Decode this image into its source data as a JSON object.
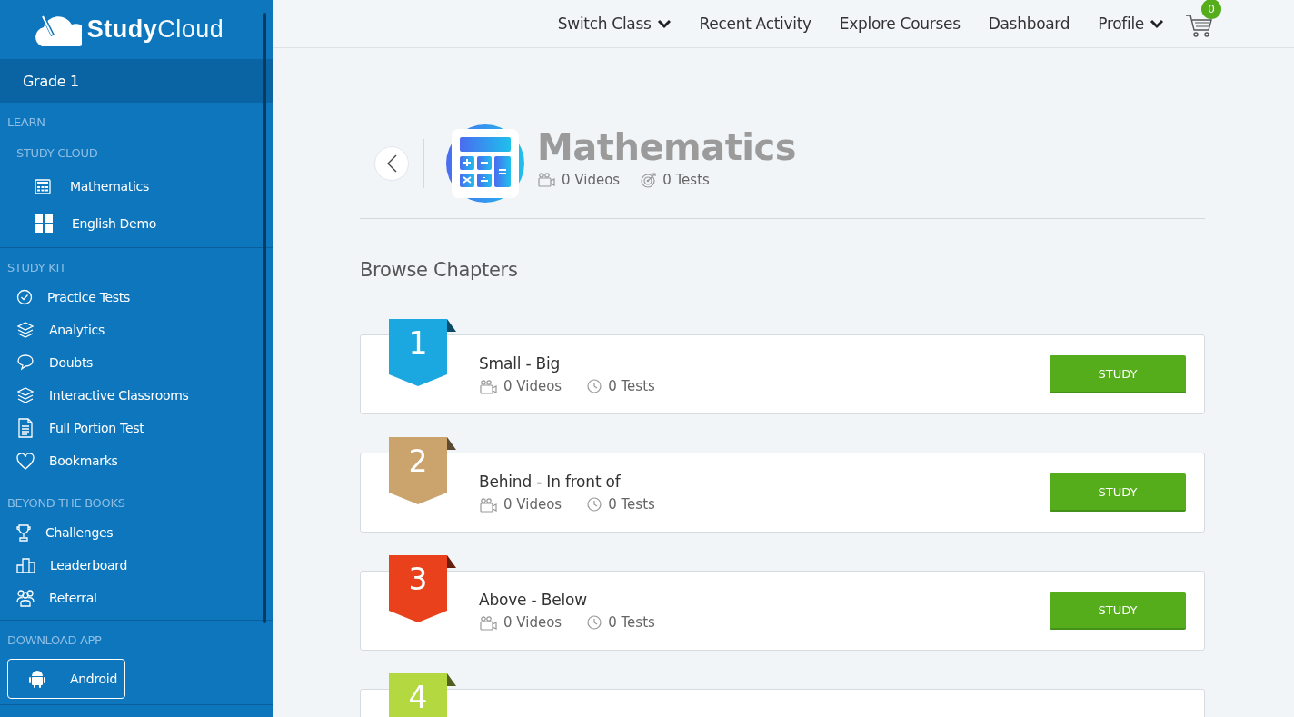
{
  "brand": {
    "bold": "Study",
    "light": "Cloud"
  },
  "grade": "Grade 1",
  "sidebar": [
    {
      "heading": "LEARN",
      "subheading": "STUDY CLOUD",
      "items": [
        {
          "label": "Mathematics"
        },
        {
          "label": "English Demo"
        }
      ]
    },
    {
      "heading": "STUDY KIT",
      "items": [
        {
          "label": "Practice Tests"
        },
        {
          "label": "Analytics"
        },
        {
          "label": "Doubts"
        },
        {
          "label": "Interactive Classrooms"
        },
        {
          "label": "Full Portion Test"
        },
        {
          "label": "Bookmarks"
        }
      ]
    },
    {
      "heading": "BEYOND THE BOOKS",
      "items": [
        {
          "label": "Challenges"
        },
        {
          "label": "Leaderboard"
        },
        {
          "label": "Referral"
        }
      ]
    },
    {
      "heading": "DOWNLOAD APP",
      "apps": [
        {
          "label": "Android"
        }
      ]
    }
  ],
  "nav": [
    {
      "label": "Switch Class",
      "dropdown": true
    },
    {
      "label": "Recent Activity",
      "dropdown": false
    },
    {
      "label": "Explore Courses",
      "dropdown": false
    },
    {
      "label": "Dashboard",
      "dropdown": false
    },
    {
      "label": "Profile",
      "dropdown": true
    }
  ],
  "cart": {
    "count": "0"
  },
  "course": {
    "title": "Mathematics",
    "videos": "0 Videos",
    "tests": "0 Tests"
  },
  "chapters_heading": "Browse Chapters",
  "chapters": [
    {
      "number": "1",
      "color": "#1ba7e0",
      "title": "Small - Big",
      "videos": "0 Videos",
      "tests": "0 Tests",
      "button": "STUDY"
    },
    {
      "number": "2",
      "color": "#caa46c",
      "title": "Behind - In front of",
      "videos": "0 Videos",
      "tests": "0 Tests",
      "button": "STUDY"
    },
    {
      "number": "3",
      "color": "#e8411c",
      "title": "Above - Below",
      "videos": "0 Videos",
      "tests": "0 Tests",
      "button": "STUDY"
    },
    {
      "number": "4",
      "color": "#b3d840"
    }
  ]
}
